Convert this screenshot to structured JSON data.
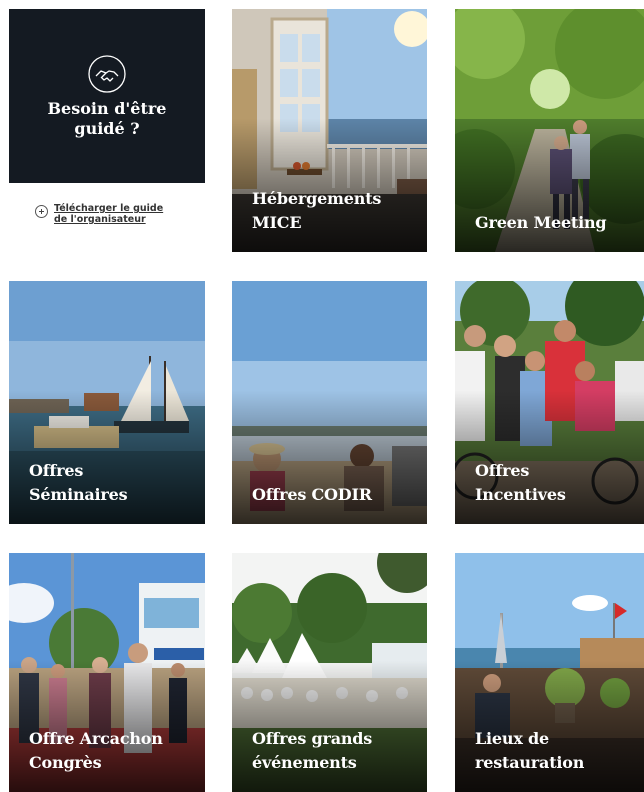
{
  "guide": {
    "title": "Besoin d'être\nguidé ?",
    "icon": "handshake-icon",
    "download_label": "Télécharger le guide\nde l'organisateur",
    "download_icon": "plus-circle-icon",
    "background": "#141a22"
  },
  "tiles": [
    {
      "label": "Hébergements\nMICE"
    },
    {
      "label": "Green Meeting"
    },
    {
      "label": "Offres\nSéminaires"
    },
    {
      "label": "Offres CODIR"
    },
    {
      "label": "Offres\nIncentives"
    },
    {
      "label": "Offre Arcachon\nCongrès"
    },
    {
      "label": "Offres grands\névénements"
    },
    {
      "label": "Lieux de\nrestauration"
    }
  ]
}
